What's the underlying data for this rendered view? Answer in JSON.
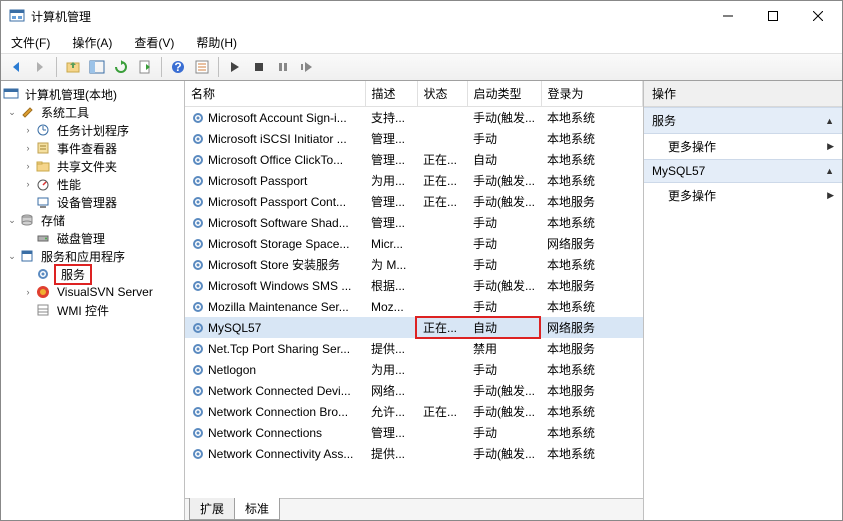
{
  "window": {
    "title": "计算机管理"
  },
  "menu": {
    "file": "文件(F)",
    "action": "操作(A)",
    "view": "查看(V)",
    "help": "帮助(H)"
  },
  "tree": {
    "root": "计算机管理(本地)",
    "systools": "系统工具",
    "sched": "任务计划程序",
    "eventv": "事件查看器",
    "shared": "共享文件夹",
    "perf": "性能",
    "devmgr": "设备管理器",
    "storage": "存储",
    "diskmgr": "磁盘管理",
    "svcapp": "服务和应用程序",
    "services": "服务",
    "vsvn": "VisualSVN Server",
    "wmi": "WMI 控件"
  },
  "cols": {
    "name": "名称",
    "desc": "描述",
    "status": "状态",
    "startup": "启动类型",
    "logon": "登录为"
  },
  "rows": [
    {
      "n": "Microsoft Account Sign-i...",
      "d": "支持...",
      "s": "",
      "t": "手动(触发...",
      "l": "本地系统"
    },
    {
      "n": "Microsoft iSCSI Initiator ...",
      "d": "管理...",
      "s": "",
      "t": "手动",
      "l": "本地系统"
    },
    {
      "n": "Microsoft Office ClickTo...",
      "d": "管理...",
      "s": "正在...",
      "t": "自动",
      "l": "本地系统"
    },
    {
      "n": "Microsoft Passport",
      "d": "为用...",
      "s": "正在...",
      "t": "手动(触发...",
      "l": "本地系统"
    },
    {
      "n": "Microsoft Passport Cont...",
      "d": "管理...",
      "s": "正在...",
      "t": "手动(触发...",
      "l": "本地服务"
    },
    {
      "n": "Microsoft Software Shad...",
      "d": "管理...",
      "s": "",
      "t": "手动",
      "l": "本地系统"
    },
    {
      "n": "Microsoft Storage Space...",
      "d": "Micr...",
      "s": "",
      "t": "手动",
      "l": "网络服务"
    },
    {
      "n": "Microsoft Store 安装服务",
      "d": "为 M...",
      "s": "",
      "t": "手动",
      "l": "本地系统"
    },
    {
      "n": "Microsoft Windows SMS ...",
      "d": "根据...",
      "s": "",
      "t": "手动(触发...",
      "l": "本地服务"
    },
    {
      "n": "Mozilla Maintenance Ser...",
      "d": "Moz...",
      "s": "",
      "t": "手动",
      "l": "本地系统"
    },
    {
      "n": "MySQL57",
      "d": "",
      "s": "正在...",
      "t": "自动",
      "l": "网络服务",
      "sel": true
    },
    {
      "n": "Net.Tcp Port Sharing Ser...",
      "d": "提供...",
      "s": "",
      "t": "禁用",
      "l": "本地服务"
    },
    {
      "n": "Netlogon",
      "d": "为用...",
      "s": "",
      "t": "手动",
      "l": "本地系统"
    },
    {
      "n": "Network Connected Devi...",
      "d": "网络...",
      "s": "",
      "t": "手动(触发...",
      "l": "本地服务"
    },
    {
      "n": "Network Connection Bro...",
      "d": "允许...",
      "s": "正在...",
      "t": "手动(触发...",
      "l": "本地系统"
    },
    {
      "n": "Network Connections",
      "d": "管理...",
      "s": "",
      "t": "手动",
      "l": "本地系统"
    },
    {
      "n": "Network Connectivity Ass...",
      "d": "提供...",
      "s": "",
      "t": "手动(触发...",
      "l": "本地系统"
    }
  ],
  "tabs": {
    "ext": "扩展",
    "std": "标准"
  },
  "actions": {
    "header": "操作",
    "sec1": "服务",
    "more": "更多操作",
    "sec2": "MySQL57"
  }
}
